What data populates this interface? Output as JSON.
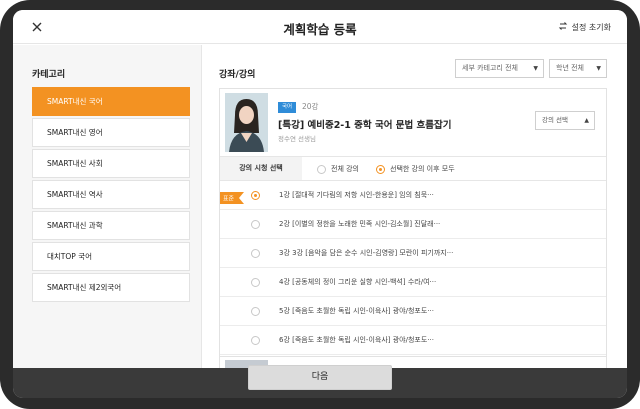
{
  "header": {
    "title": "계획학습 등록",
    "reset_label": "설정 초기화"
  },
  "sidebar": {
    "title": "카테고리",
    "items": [
      {
        "label": "SMART내신 국어",
        "active": true
      },
      {
        "label": "SMART내신 영어",
        "active": false
      },
      {
        "label": "SMART내신 사회",
        "active": false
      },
      {
        "label": "SMART내신 역사",
        "active": false
      },
      {
        "label": "SMART내신 과학",
        "active": false
      },
      {
        "label": "대치TOP 국어",
        "active": false
      },
      {
        "label": "SMART내신 제2외국어",
        "active": false
      }
    ]
  },
  "main": {
    "title": "강좌/강의",
    "filters": {
      "subcategory": "세부 카테고리 전체",
      "grade": "학년 전체"
    },
    "course": {
      "badge": "국어",
      "lecture_count": "20강",
      "name": "[특강] 예비중2-1 중학 국어 문법 흐름잡기",
      "teacher": "정수연 선생님",
      "lecture_select": "강의 선택"
    },
    "start_point": {
      "label": "강의 시청 선택",
      "option_all": "전체 강의",
      "option_after": "선택한 강의 이후 모두",
      "selected": "option_after"
    },
    "start_flag": "표준",
    "lectures": [
      {
        "text": "1강 [절대적 기다림의 저항 시인-한용운] 임의 침묵···",
        "selected": true
      },
      {
        "text": "2강 [이별의 정한을 노래한 민족 시인-김소월] 진달래···",
        "selected": false
      },
      {
        "text": "3강 3강 [음악을 담은 순수 시인-김영랑] 모란이 피기까지···",
        "selected": false
      },
      {
        "text": "4강 [공동체의 정이 그리운 실향 시인-백석] 수라/여···",
        "selected": false
      },
      {
        "text": "5강 [죽음도 초월한 독립 시인-이육사] 광야/청포도···",
        "selected": false
      },
      {
        "text": "6강 [죽음도 초월한 독립 시인-이육사] 광야/청포도···",
        "selected": false
      }
    ]
  },
  "footer": {
    "next_label": "다음"
  },
  "colors": {
    "accent": "#f39222",
    "badge": "#2f8cd8",
    "frame": "#2b2b2b"
  }
}
